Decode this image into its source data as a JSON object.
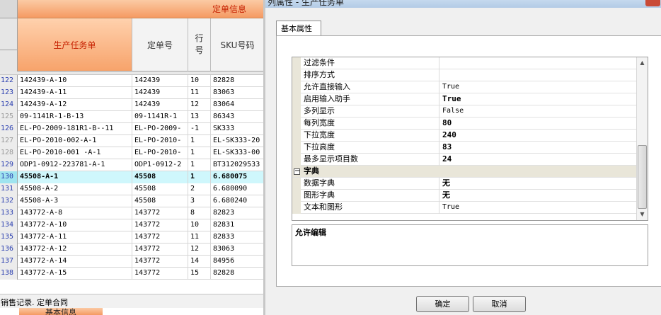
{
  "grid": {
    "group_header": "定单信息",
    "columns": {
      "task": "生产任务单",
      "order": "定单号",
      "line": "行\n号",
      "sku": "SKU号码"
    },
    "rows": [
      {
        "n": "122",
        "task": "142439-A-10",
        "order": "142439",
        "line": "10",
        "sku": "82828"
      },
      {
        "n": "123",
        "task": "142439-A-11",
        "order": "142439",
        "line": "11",
        "sku": "83063"
      },
      {
        "n": "124",
        "task": "142439-A-12",
        "order": "142439",
        "line": "12",
        "sku": "83064"
      },
      {
        "n": "125",
        "task": "09-1141R-1-B-13",
        "order": "09-1141R-1",
        "line": "13",
        "sku": "86343"
      },
      {
        "n": "126",
        "task": "EL-PO-2009-181R1-B--11",
        "order": "EL-PO-2009-",
        "line": "-1",
        "sku": "SK333"
      },
      {
        "n": "127",
        "task": "EL-PO-2010-002-A-1",
        "order": "EL-PO-2010-",
        "line": "1",
        "sku": "EL-SK333-20"
      },
      {
        "n": "128",
        "task": "EL-PO-2010-001 -A-1",
        "order": "EL-PO-2010-",
        "line": "1",
        "sku": "EL-SK333-00"
      },
      {
        "n": "129",
        "task": "ODP1-0912-223781-A-1",
        "order": "ODP1-0912-2",
        "line": "1",
        "sku": "BT312029533"
      },
      {
        "n": "130",
        "task": "45508-A-1",
        "order": "45508",
        "line": "1",
        "sku": "6.680075"
      },
      {
        "n": "131",
        "task": "45508-A-2",
        "order": "45508",
        "line": "2",
        "sku": "6.680090"
      },
      {
        "n": "132",
        "task": "45508-A-3",
        "order": "45508",
        "line": "3",
        "sku": "6.680240"
      },
      {
        "n": "133",
        "task": "143772-A-8",
        "order": "143772",
        "line": "8",
        "sku": "82823"
      },
      {
        "n": "134",
        "task": "143772-A-10",
        "order": "143772",
        "line": "10",
        "sku": "82831"
      },
      {
        "n": "135",
        "task": "143772-A-11",
        "order": "143772",
        "line": "11",
        "sku": "82833"
      },
      {
        "n": "136",
        "task": "143772-A-12",
        "order": "143772",
        "line": "12",
        "sku": "83063"
      },
      {
        "n": "137",
        "task": "143772-A-14",
        "order": "143772",
        "line": "14",
        "sku": "84956"
      },
      {
        "n": "138",
        "task": "143772-A-15",
        "order": "143772",
        "line": "15",
        "sku": "82828"
      }
    ],
    "selected_row": "130",
    "status_text": "销售记录. 定单合同",
    "bottom_tab": "基本信息"
  },
  "dialog": {
    "title": "列属性 - 生产任务单",
    "tab": "基本属性",
    "properties": [
      {
        "name": "过滤条件",
        "value": "",
        "bold": false
      },
      {
        "name": "排序方式",
        "value": "",
        "bold": false
      },
      {
        "name": "允许直接输入",
        "value": "True",
        "bold": false
      },
      {
        "name": "启用输入助手",
        "value": "True",
        "bold": true
      },
      {
        "name": "多列显示",
        "value": "False",
        "bold": false
      },
      {
        "name": "每列宽度",
        "value": "80",
        "bold": true
      },
      {
        "name": "下拉宽度",
        "value": "240",
        "bold": true
      },
      {
        "name": "下拉高度",
        "value": "83",
        "bold": true
      },
      {
        "name": "最多显示项目数",
        "value": "24",
        "bold": true
      }
    ],
    "category": "字典",
    "category_properties": [
      {
        "name": "数据字典",
        "value": "无",
        "bold": true
      },
      {
        "name": "图形字典",
        "value": "无",
        "bold": true
      },
      {
        "name": "文本和图形",
        "value": "True",
        "bold": false
      }
    ],
    "description_title": "允许编辑",
    "ok_label": "确定",
    "cancel_label": "取消"
  }
}
